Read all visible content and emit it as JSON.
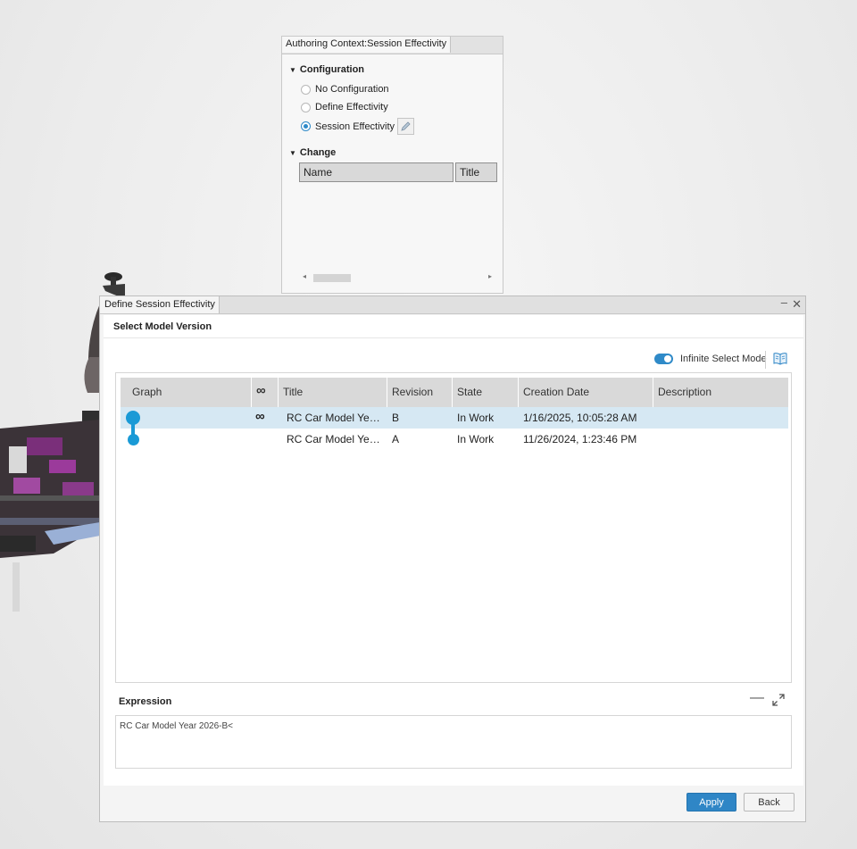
{
  "authoring_panel": {
    "tab_title": "Authoring Context:Session Effectivity",
    "configuration_section": "Configuration",
    "options": [
      {
        "label": "No Configuration",
        "selected": false
      },
      {
        "label": "Define Effectivity",
        "selected": false
      },
      {
        "label": "Session Effectivity",
        "selected": true
      }
    ],
    "change_section": "Change",
    "columns": [
      "Name",
      "Title"
    ]
  },
  "dialog": {
    "tab_title": "Define Session Effectivity",
    "minimize_glyph": "–",
    "close_glyph": "✕",
    "section_title": "Select Model Version",
    "infinite_select_mode_label": "Infinite Select Mode",
    "infinite_select_mode_on": true,
    "table": {
      "columns": [
        "Graph",
        "∞",
        "Title",
        "Revision",
        "State",
        "Creation Date",
        "Description"
      ],
      "rows": [
        {
          "infinite": "∞",
          "title": "RC Car Model Ye…",
          "revision": "B",
          "state": "In Work",
          "created": "1/16/2025, 10:05:28 AM",
          "description": "",
          "selected": true
        },
        {
          "infinite": "",
          "title": "RC Car Model Ye…",
          "revision": "A",
          "state": "In Work",
          "created": "11/26/2024, 1:23:46 PM",
          "description": "",
          "selected": false
        }
      ]
    },
    "expression_title": "Expression",
    "expression_value": "RC Car Model Year 2026-B<",
    "apply_label": "Apply",
    "back_label": "Back"
  },
  "colors": {
    "accent": "#2f86c6",
    "graph_node": "#1a9ad6",
    "selected_row": "#d6e8f3"
  }
}
